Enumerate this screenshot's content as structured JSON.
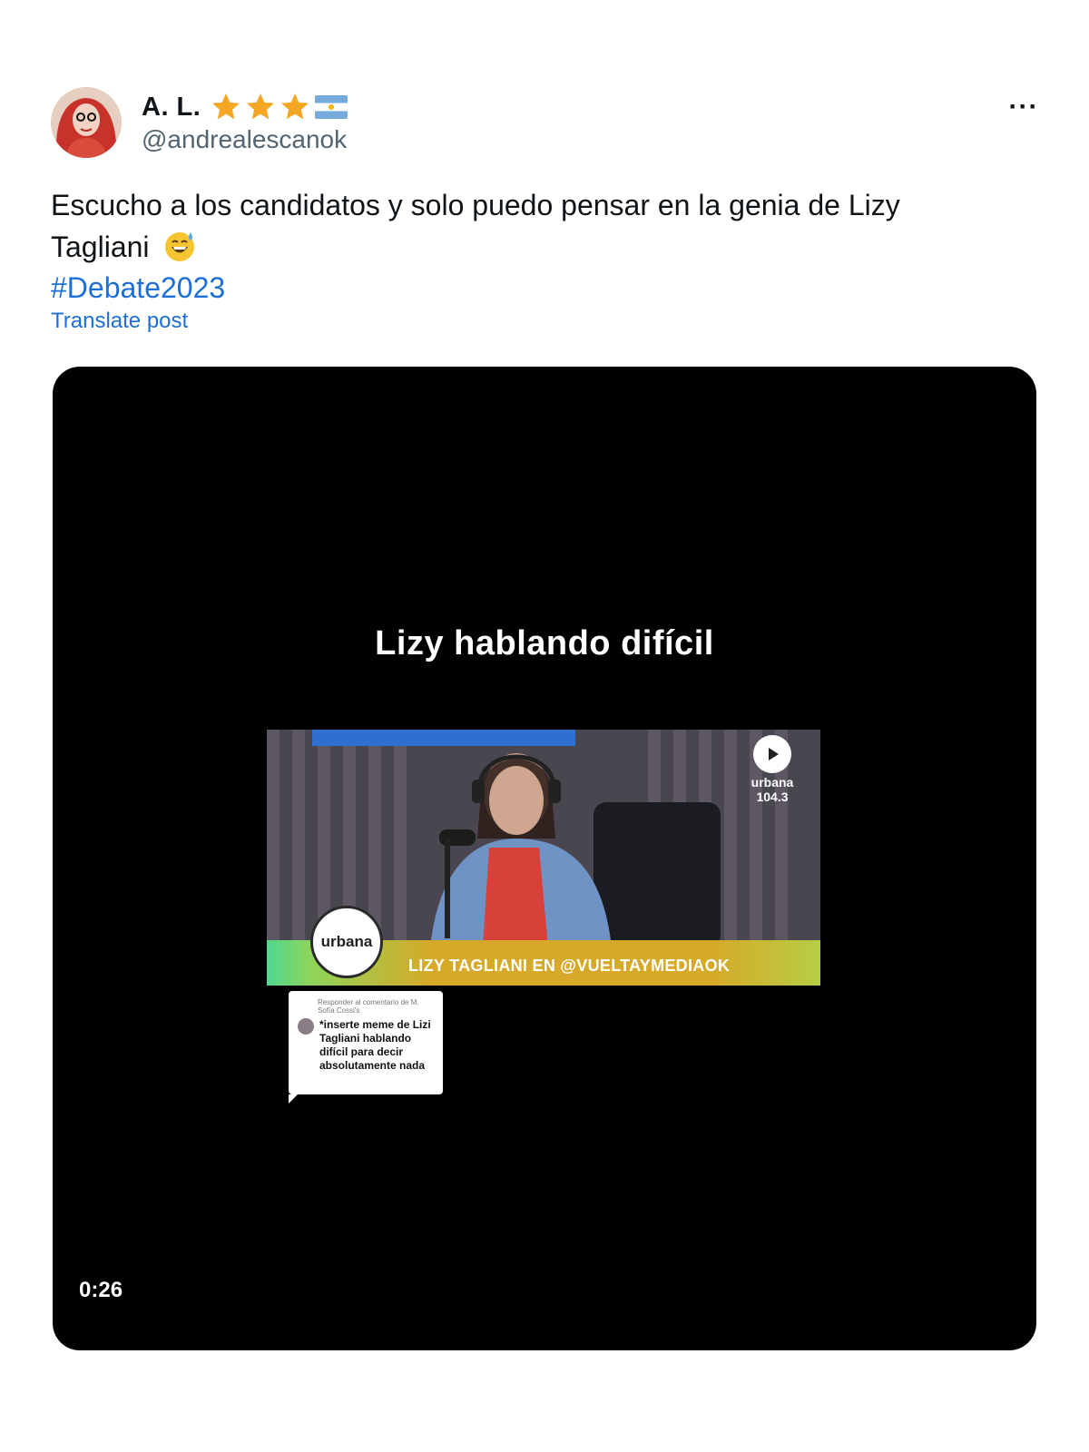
{
  "user": {
    "display_name": "A. L.",
    "handle": "@andrealescanok",
    "badges": [
      "star-icon",
      "star-icon",
      "star-icon",
      "argentina-flag-icon"
    ]
  },
  "menu": {
    "more_label": "···"
  },
  "post": {
    "text": "Escucho a los candidatos y solo puedo pensar en la genia de Lizy Tagliani",
    "emoji": "grinning-face-with-sweat-icon",
    "hashtag": "#Debate2023",
    "translate_label": "Translate post"
  },
  "video": {
    "caption": "Lizy hablando difícil",
    "lower_third_text": "LIZY TAGLIANI EN @VUELTAYMEDIAOK",
    "station_logo": "urbana 104.3",
    "reply_card": {
      "header": "Responder al comentario de M. Sofía Cossi's",
      "text": "*inserte meme de Lizi Tagliani hablando difícil para decir absolutamente nada"
    },
    "duration": "0:26"
  },
  "colors": {
    "link": "#1d6fd8",
    "secondary_text": "#536471",
    "media_bg": "#000000"
  }
}
